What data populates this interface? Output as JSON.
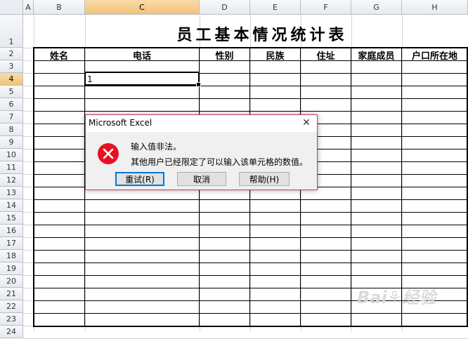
{
  "sheet": {
    "columns": [
      "A",
      "B",
      "C",
      "D",
      "E",
      "F",
      "G",
      "H"
    ],
    "rows": [
      "1",
      "2",
      "3",
      "4",
      "5",
      "6",
      "7",
      "8",
      "9",
      "10",
      "11",
      "12",
      "13",
      "14",
      "15",
      "16",
      "17",
      "18",
      "19",
      "20",
      "21",
      "22",
      "23",
      "24"
    ],
    "title": "员工基本情况统计表",
    "headers": [
      "姓名",
      "电话",
      "性别",
      "民族",
      "住址",
      "家庭成员",
      "户口所在地"
    ],
    "active_cell": "C4",
    "active_cell_value": "1"
  },
  "dialog": {
    "title": "Microsoft Excel",
    "message_line1": "输入值非法。",
    "message_line2": "其他用户已经限定了可以输入该单元格的数值。",
    "buttons": {
      "retry": "重试(R)",
      "cancel": "取消",
      "help": "帮助(H)"
    },
    "close_glyph": "✕",
    "icon": "error-icon"
  },
  "colors": {
    "accent": "#0078d7",
    "error_red": "#e81123",
    "dialog_border": "#d03a64",
    "selected_header": "#f2c27a"
  }
}
